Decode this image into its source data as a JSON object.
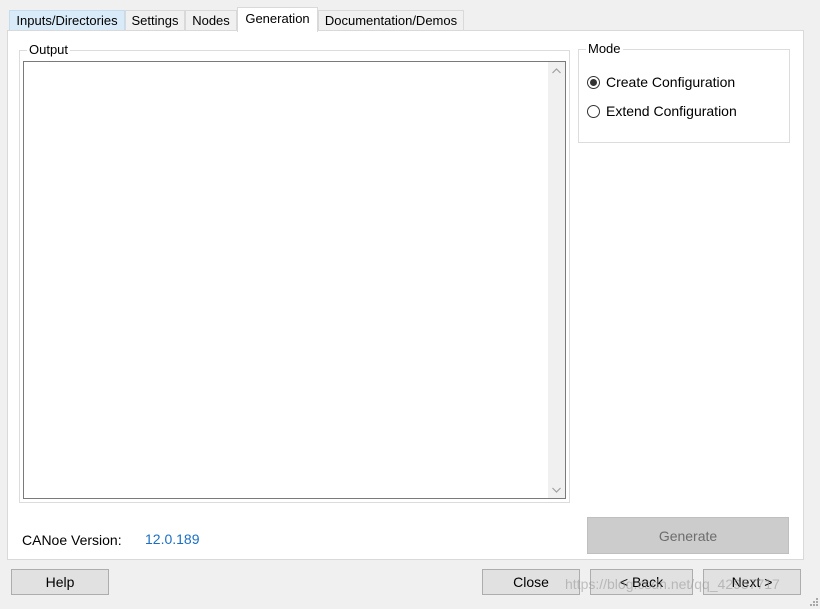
{
  "tabs": [
    {
      "label": "Inputs/Directories"
    },
    {
      "label": "Settings"
    },
    {
      "label": "Nodes"
    },
    {
      "label": "Generation"
    },
    {
      "label": "Documentation/Demos"
    }
  ],
  "output": {
    "legend": "Output",
    "text": ""
  },
  "mode": {
    "legend": "Mode",
    "options": [
      {
        "label": "Create Configuration",
        "selected": true
      },
      {
        "label": "Extend Configuration",
        "selected": false
      }
    ]
  },
  "version": {
    "label": "CANoe Version:",
    "value": "12.0.189"
  },
  "buttons": {
    "generate": "Generate",
    "help": "Help",
    "close": "Close",
    "back": "< Back",
    "next": "Next >"
  },
  "watermark": "https://blog.csdn.net/qq_42957717",
  "colors": {
    "link_blue": "#1a6fc4",
    "selected_tab": "#ffffff",
    "first_tab": "#d9ebf9",
    "disabled_button": "#cccccc"
  }
}
